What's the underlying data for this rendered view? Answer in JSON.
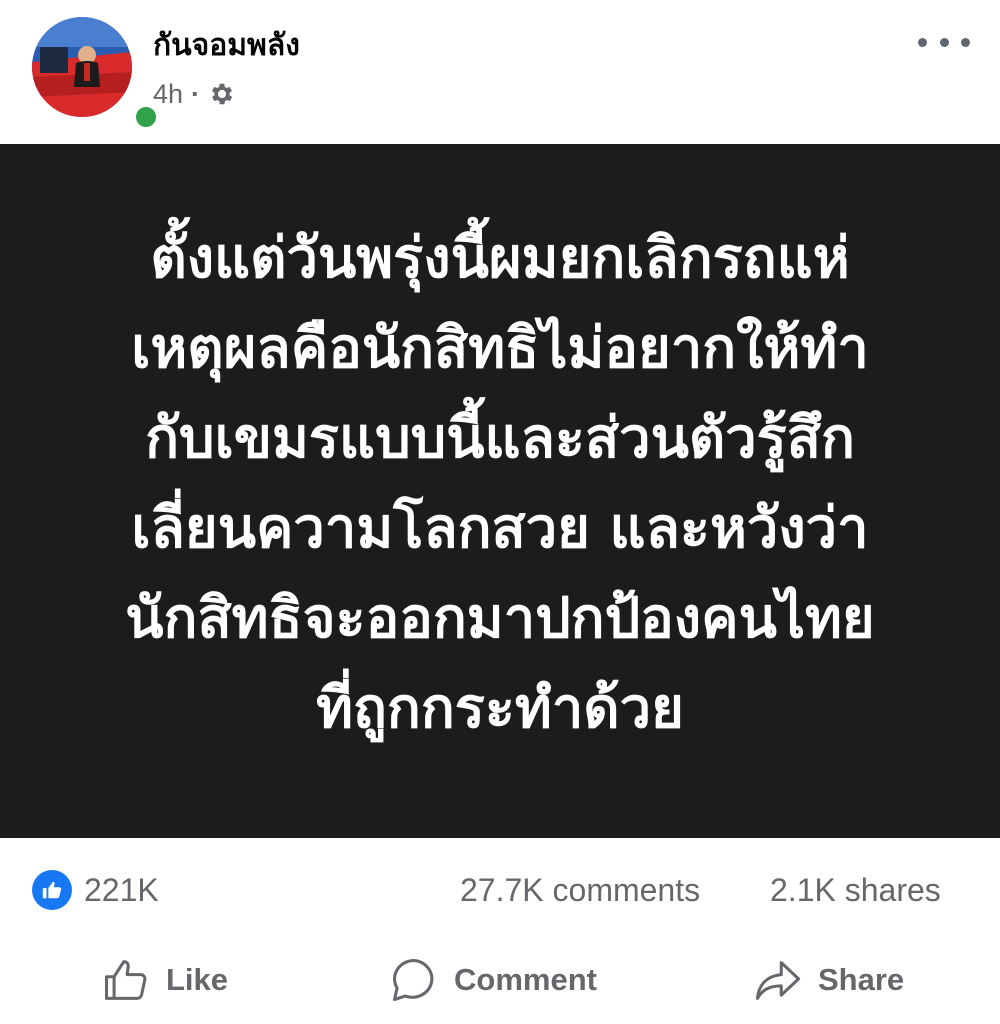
{
  "post": {
    "author": "กันจอมพลัง",
    "time": "4h",
    "separator": "·",
    "privacy_icon": "gear-icon",
    "more_icon": "more-horizontal-icon",
    "text": "ตั้งแต่วันพรุ่งนี้ผมยกเลิกรถแห่\nเหตุผลคือนักสิทธิไม่อยากให้ทำ\nกับเขมรแบบนี้และส่วนตัวรู้สึก\nเลี่ยนความโลกสวย และหวังว่า\nนักสิทธิจะออกมาปกป้องคนไทย\nที่ถูกกระทำด้วย"
  },
  "stats": {
    "reactions": "221K",
    "comments": "27.7K comments",
    "shares": "2.1K shares"
  },
  "actions": {
    "like": "Like",
    "comment": "Comment",
    "share": "Share"
  },
  "colors": {
    "accent": "#1877f2",
    "online": "#31a24c",
    "post_bg": "#1c1c1c",
    "muted_text": "#65676b"
  }
}
